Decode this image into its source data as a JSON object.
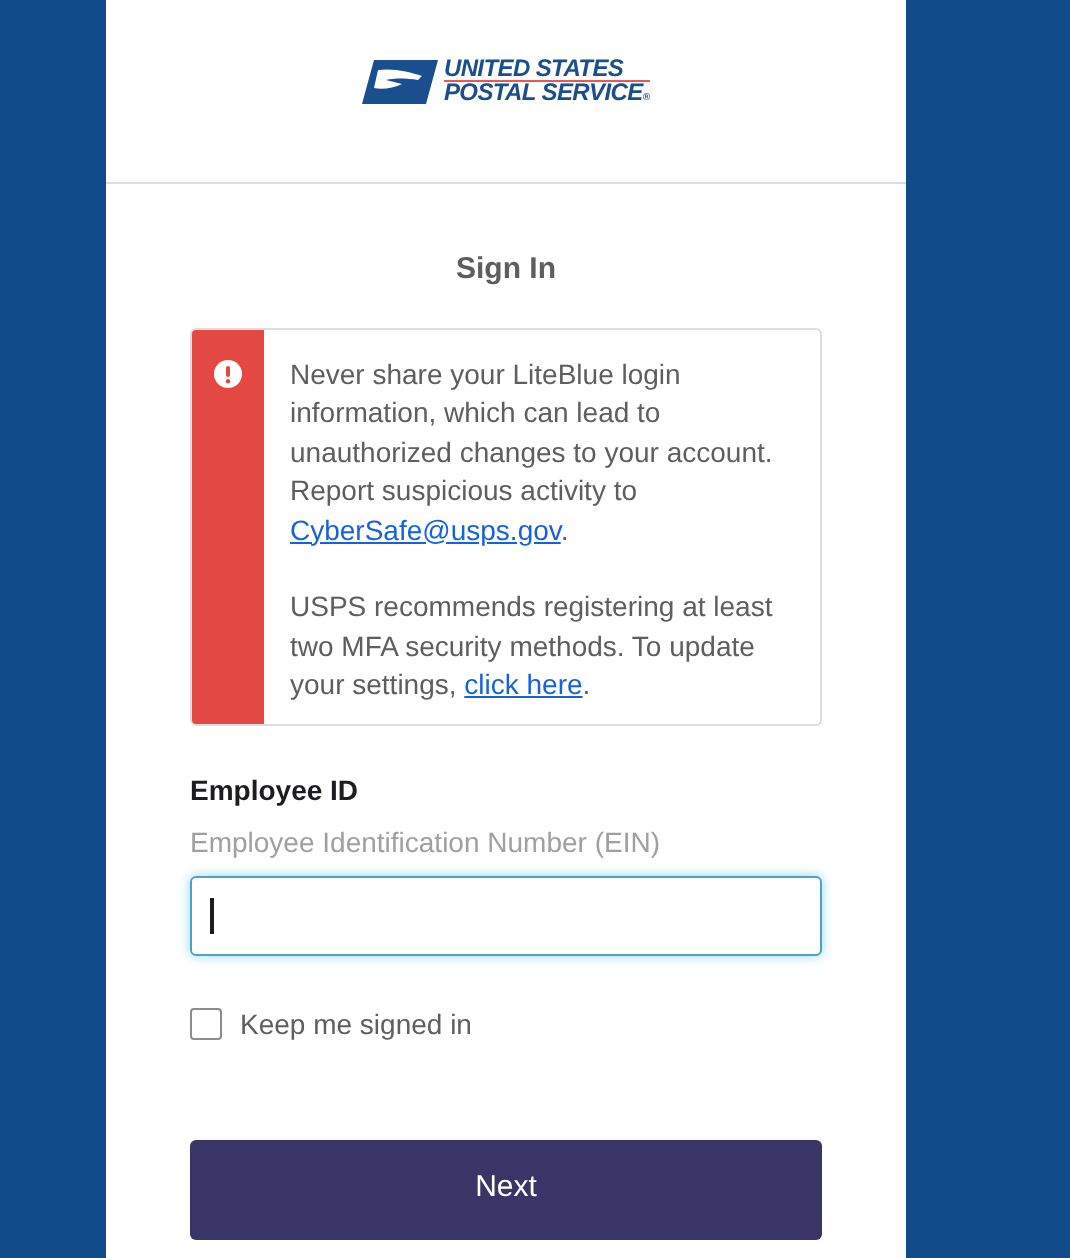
{
  "logo": {
    "line_1": "UNITED STATES",
    "line_2": "POSTAL SERVICE",
    "mark": "®"
  },
  "heading": "Sign In",
  "alert": {
    "kind": "error",
    "paragraphs": [
      {
        "before": "Never share your LiteBlue login information, which can lead to unauthorized changes to your account. Report suspicious activity to ",
        "link": "CyberSafe@usps.gov",
        "after": "."
      },
      {
        "before": "USPS recommends registering at least two MFA security methods. To update your settings, ",
        "link": "click here",
        "after": "."
      }
    ]
  },
  "field": {
    "label": "Employee ID",
    "hint": "Employee Identification Number (EIN)",
    "focused": true
  },
  "remember": {
    "label": "Keep me signed in",
    "checked": false
  },
  "submit": "Next"
}
